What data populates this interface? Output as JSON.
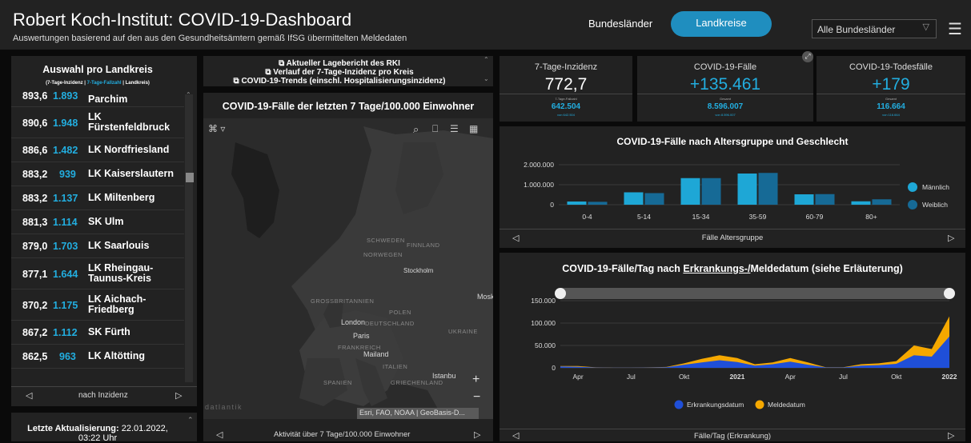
{
  "header": {
    "title": "Robert Koch-Institut: COVID-19-Dashboard",
    "subtitle": "Auswertungen basierend auf den aus den Gesundheitsämtern gemäß IfSG übermittelten Meldedaten",
    "nav_bundeslaender": "Bundesländer",
    "nav_landkreise": "Landkreise",
    "select_value": "Alle Bundesländer"
  },
  "left": {
    "title": "Auswahl pro Landkreis",
    "legend_a": "(7-Tage-Inzidenz | ",
    "legend_b": "7-Tage-Fallzahl",
    "legend_c": " | Landkreis)",
    "partial": {
      "v1": "893,6",
      "v2": "1.893",
      "name": "Parchim"
    },
    "items": [
      {
        "v1": "890,6",
        "v2": "1.948",
        "name": "LK Fürstenfeldbruck"
      },
      {
        "v1": "886,6",
        "v2": "1.482",
        "name": "LK Nordfriesland"
      },
      {
        "v1": "883,2",
        "v2": "939",
        "name": "LK Kaiserslautern"
      },
      {
        "v1": "883,2",
        "v2": "1.137",
        "name": "LK Miltenberg"
      },
      {
        "v1": "881,3",
        "v2": "1.114",
        "name": "SK Ulm"
      },
      {
        "v1": "879,0",
        "v2": "1.703",
        "name": "LK Saarlouis"
      },
      {
        "v1": "877,1",
        "v2": "1.644",
        "name": "LK Rheingau-Taunus-Kreis"
      },
      {
        "v1": "870,2",
        "v2": "1.175",
        "name": "LK Aichach-Friedberg"
      },
      {
        "v1": "867,2",
        "v2": "1.112",
        "name": "SK Fürth"
      },
      {
        "v1": "862,5",
        "v2": "963",
        "name": "LK Altötting"
      }
    ],
    "pager_label": "nach Inzidenz",
    "update_label": "Letzte Aktualisierung:",
    "update_date": "22.01.2022,",
    "update_time": "03:22 Uhr"
  },
  "links": {
    "l1": "Aktueller Lagebericht des RKI",
    "l2": "Verlauf der 7-Tage-Inzidenz pro Kreis",
    "l3": "COVID-19-Trends (einschl. Hospitalisierungsinzidenz)"
  },
  "map": {
    "title": "COVID-19-Fälle der letzten 7 Tage/100.000 Einwohner",
    "labels": {
      "schweden": "SCHWEDEN",
      "finnland": "FINNLAND",
      "norwegen": "NORWEGEN",
      "stockholm": "Stockholm",
      "gb": "GROSSBRITANNIEN",
      "polen": "POLEN",
      "london": "London",
      "deutschland": "DEUTSCHLAND",
      "ukraine": "UKRAINE",
      "paris": "Paris",
      "frankreich": "FRANKREICH",
      "mailand": "Mailand",
      "italien": "ITALIEN",
      "spanien": "SPANIEN",
      "griechenland": "GRIECHENLAND",
      "istanbul": "Istanbu",
      "moskau": "Mosk",
      "atlantik": "datlantik"
    },
    "attribution": "Esri, FAO, NOAA | GeoBasis-D...",
    "pager_label": "Aktivität über 7 Tage/100.000 Einwohner"
  },
  "kpi": [
    {
      "title": "7-Tage-Inzidenz",
      "value": "772,7",
      "l1": "7-Tage-Fallzahl",
      "l2": "642.504",
      "l3": "von 642.504"
    },
    {
      "title": "COVID-19-Fälle",
      "value": "+135.461",
      "l1": "Gesamt",
      "l2": "8.596.007",
      "l3": "von 8.596.007"
    },
    {
      "title": "COVID-19-Todesfälle",
      "value": "+179",
      "l1": "Gesamt",
      "l2": "116.664",
      "l3": "von 116.664"
    }
  ],
  "colors": {
    "accent": "#22aee0",
    "male": "#1ea7d6",
    "female": "#166a96",
    "meldedatum": "#f5a800",
    "erkrankung": "#1f4fd8"
  },
  "age_chart": {
    "title": "COVID-19-Fälle nach Altersgruppe und Geschlecht",
    "yticks": [
      "2.000.000",
      "1.000.000",
      "0"
    ],
    "legend": [
      "Männlich",
      "Weiblich"
    ],
    "pager_label": "Fälle Altersgruppe"
  },
  "daily_chart": {
    "title_a": "COVID-19-Fälle/Tag nach ",
    "title_link": "Erkrankungs-/",
    "title_b": "Meldedatum (siehe Erläuterung)",
    "yticks": [
      "150.000",
      "100.000",
      "50.000",
      "0"
    ],
    "xticks": [
      "Apr",
      "Jul",
      "Okt",
      "2021",
      "Apr",
      "Jul",
      "Okt",
      "2022"
    ],
    "legend": [
      "Erkrankungsdatum",
      "Meldedatum"
    ],
    "pager_label": "Fälle/Tag (Erkrankung)"
  },
  "chart_data": [
    {
      "type": "bar",
      "title": "COVID-19-Fälle nach Altersgruppe und Geschlecht",
      "xlabel": "Fälle Altersgruppe",
      "categories": [
        "0-4",
        "5-14",
        "15-34",
        "35-59",
        "60-79",
        "80+"
      ],
      "series": [
        {
          "name": "Männlich",
          "values": [
            160000,
            620000,
            1330000,
            1560000,
            520000,
            170000
          ]
        },
        {
          "name": "Weiblich",
          "values": [
            145000,
            580000,
            1330000,
            1590000,
            530000,
            270000
          ]
        }
      ],
      "ylim": [
        0,
        2000000
      ],
      "legend": "right"
    },
    {
      "type": "area",
      "title": "COVID-19-Fälle/Tag nach Erkrankungs-/Meldedatum (siehe Erläuterung)",
      "xlabel": "Fälle/Tag (Erkrankung)",
      "x": [
        "2020-03",
        "2020-04",
        "2020-05",
        "2020-06",
        "2020-07",
        "2020-08",
        "2020-09",
        "2020-10",
        "2020-11",
        "2020-12",
        "2021-01",
        "2021-02",
        "2021-03",
        "2021-04",
        "2021-05",
        "2021-06",
        "2021-07",
        "2021-08",
        "2021-09",
        "2021-10",
        "2021-11",
        "2021-12",
        "2022-01"
      ],
      "series": [
        {
          "name": "Meldedatum",
          "values": [
            4000,
            4000,
            1000,
            500,
            500,
            1000,
            2000,
            10000,
            20000,
            28000,
            22000,
            8000,
            12000,
            22000,
            12000,
            1500,
            1500,
            8000,
            10000,
            15000,
            50000,
            42000,
            115000
          ]
        },
        {
          "name": "Erkrankungsdatum",
          "values": [
            3000,
            2500,
            700,
            300,
            300,
            700,
            1200,
            7000,
            12000,
            17000,
            13000,
            5000,
            8000,
            14000,
            7000,
            900,
            900,
            5000,
            6000,
            9000,
            28000,
            25000,
            70000
          ]
        }
      ],
      "ylim": [
        0,
        150000
      ],
      "legend": "bottom"
    }
  ]
}
